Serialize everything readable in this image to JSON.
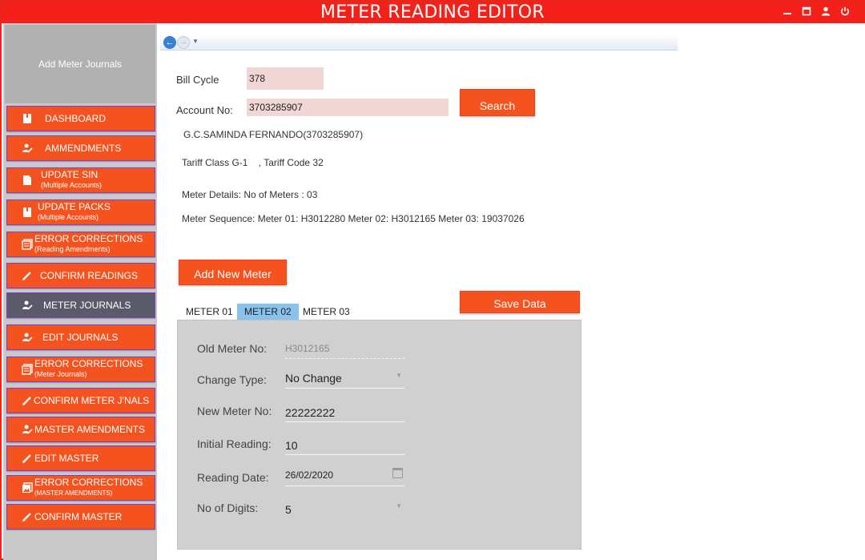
{
  "app": {
    "title": "METER READING EDITOR"
  },
  "sidebar": {
    "header": "Add Meter Journals",
    "items": [
      {
        "label": "DASHBOARD",
        "sub": ""
      },
      {
        "label": "AMMENDMENTS",
        "sub": ""
      },
      {
        "label": "UPDATE SIN",
        "sub": "(Multiple Accounts)"
      },
      {
        "label": "UPDATE PACKS",
        "sub": "(Multiple Accounts)"
      },
      {
        "label": "ERROR CORRECTIONS",
        "sub": "(Reading Amendments)"
      },
      {
        "label": "CONFIRM READINGS",
        "sub": ""
      },
      {
        "label": "METER JOURNALS",
        "sub": ""
      },
      {
        "label": "EDIT JOURNALS",
        "sub": ""
      },
      {
        "label": "ERROR CORRECTIONS",
        "sub": "(Meter Journals)"
      },
      {
        "label": "CONFIRM METER J'NALS",
        "sub": ""
      },
      {
        "label": "MASTER AMENDMENTS",
        "sub": ""
      },
      {
        "label": "EDIT MASTER",
        "sub": ""
      },
      {
        "label": "ERROR CORRECTIONS",
        "sub": "(MASTER AMENDMENTS)"
      },
      {
        "label": "CONFIRM MASTER",
        "sub": ""
      }
    ],
    "active_index": 6
  },
  "form": {
    "bill_cycle_label": "Bill Cycle",
    "bill_cycle_value": "378",
    "account_label": "Account No:",
    "account_value": "3703285907",
    "search_label": "Search",
    "customer_name": "G.C.SAMINDA FERNANDO(3703285907)",
    "tariff": "Tariff Class G-1    , Tariff Code 32",
    "meter_details": "Meter Details: No of Meters : 03",
    "meter_sequence": "Meter Sequence: Meter 01: H3012280 Meter 02: H3012165 Meter 03: 19037026",
    "add_meter_label": "Add New Meter",
    "save_label": "Save Data"
  },
  "tabs": [
    {
      "label": "METER 01"
    },
    {
      "label": "METER 02"
    },
    {
      "label": "METER 03"
    }
  ],
  "selected_tab": 1,
  "meter": {
    "old_meter_label": "Old Meter No:",
    "old_meter_value": "H3012165",
    "change_type_label": "Change Type:",
    "change_type_value": "No Change",
    "new_meter_label": "New Meter No:",
    "new_meter_value": "22222222",
    "initial_reading_label": "Initial Reading:",
    "initial_reading_value": "10",
    "reading_date_label": "Reading Date:",
    "reading_date_value": "26/02/2020",
    "digits_label": "No of Digits:",
    "digits_value": "5"
  },
  "colors": {
    "title_bar": "#f4211b",
    "nav_button": "#f4521e",
    "nav_active": "#5a5a6a",
    "selected_tab": "#89c2ec",
    "input_bg": "#f1d6d6"
  },
  "icons": {
    "minimize": "minimize-icon",
    "maximize": "maximize-icon",
    "user": "user-icon",
    "power": "power-icon"
  }
}
